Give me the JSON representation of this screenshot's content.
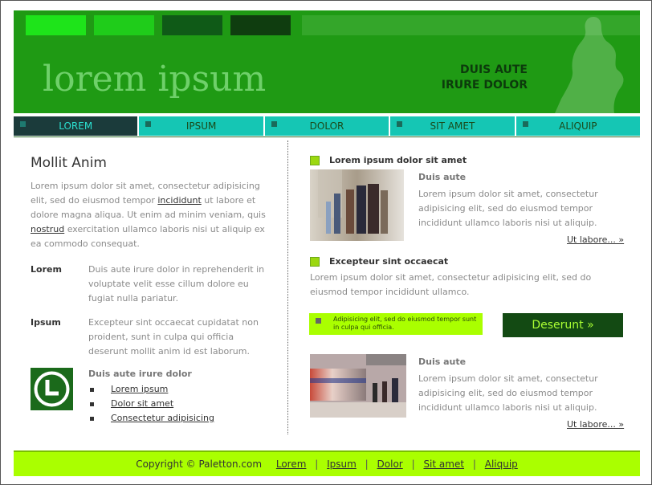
{
  "header": {
    "logo": "lorem ipsum",
    "tagline_line1": "DUIS AUTE",
    "tagline_line2": "IRURE DOLOR",
    "swatches": [
      "#1ee41a",
      "#1fcc1a",
      "#0f5a17",
      "#0f3d0f"
    ],
    "bar_color": "#38a82e"
  },
  "nav": {
    "items": [
      {
        "label": "LOREM",
        "active": true
      },
      {
        "label": "IPSUM",
        "active": false
      },
      {
        "label": "DOLOR",
        "active": false
      },
      {
        "label": "SIT AMET",
        "active": false
      },
      {
        "label": "ALIQUIP",
        "active": false
      }
    ],
    "colors": {
      "active_bg": "#1b3b3b",
      "active_text": "#2be0d0",
      "bg": "#15c6b4",
      "text": "#1a4a1a"
    }
  },
  "left": {
    "title": "Mollit Anim",
    "intro": {
      "t1": "Lorem ipsum dolor sit amet, consectetur adipisicing elit, sed do eiusmod tempor ",
      "link1": "incididunt",
      "t2": " ut labore et dolore magna aliqua. Ut enim ad minim veniam, quis ",
      "link2": "nostrud",
      "t3": " exercitation ullamco laboris nisi ut aliquip ex ea commodo consequat."
    },
    "definitions": [
      {
        "term": "Lorem",
        "desc": "Duis aute irure dolor in reprehenderit in voluptate velit esse cillum dolore eu fugiat nulla pariatur."
      },
      {
        "term": "Ipsum",
        "desc": "Excepteur sint occaecat cupidatat non proident, sunt in culpa qui officia deserunt mollit anim id est laborum."
      }
    ],
    "links_title": "Duis aute irure dolor",
    "links": [
      "Lorem ipsum",
      "Dolor sit amet",
      "Consectetur adipisicing"
    ]
  },
  "right": {
    "article1": {
      "heading": "Lorem ipsum dolor sit amet",
      "subtitle": "Duis aute",
      "text": "Lorem ipsum dolor sit amet, consectetur adipisicing elit, sed do eiusmod tempor incididunt ullamco laboris nisi ut aliquip.",
      "more": "Ut labore... »"
    },
    "article2": {
      "heading": "Excepteur sint occaecat",
      "text": "Lorem ipsum dolor sit amet, consectetur adipisicing elit, sed do eiusmod tempor incididunt ullamco."
    },
    "promo": "Adipisicing elit, sed do eiusmod tempor sunt in culpa qui officia.",
    "cta": "Deserunt »",
    "article3": {
      "subtitle": "Duis aute",
      "text": "Lorem ipsum dolor sit amet, consectetur adipisicing elit, sed do eiusmod tempor incididunt ullamco laboris nisi ut aliquip.",
      "more": "Ut labore... »"
    }
  },
  "footer": {
    "copyright": "Copyright © Paletton.com",
    "links": [
      "Lorem",
      "Ipsum",
      "Dolor",
      "Sit amet",
      "Aliquip"
    ]
  }
}
